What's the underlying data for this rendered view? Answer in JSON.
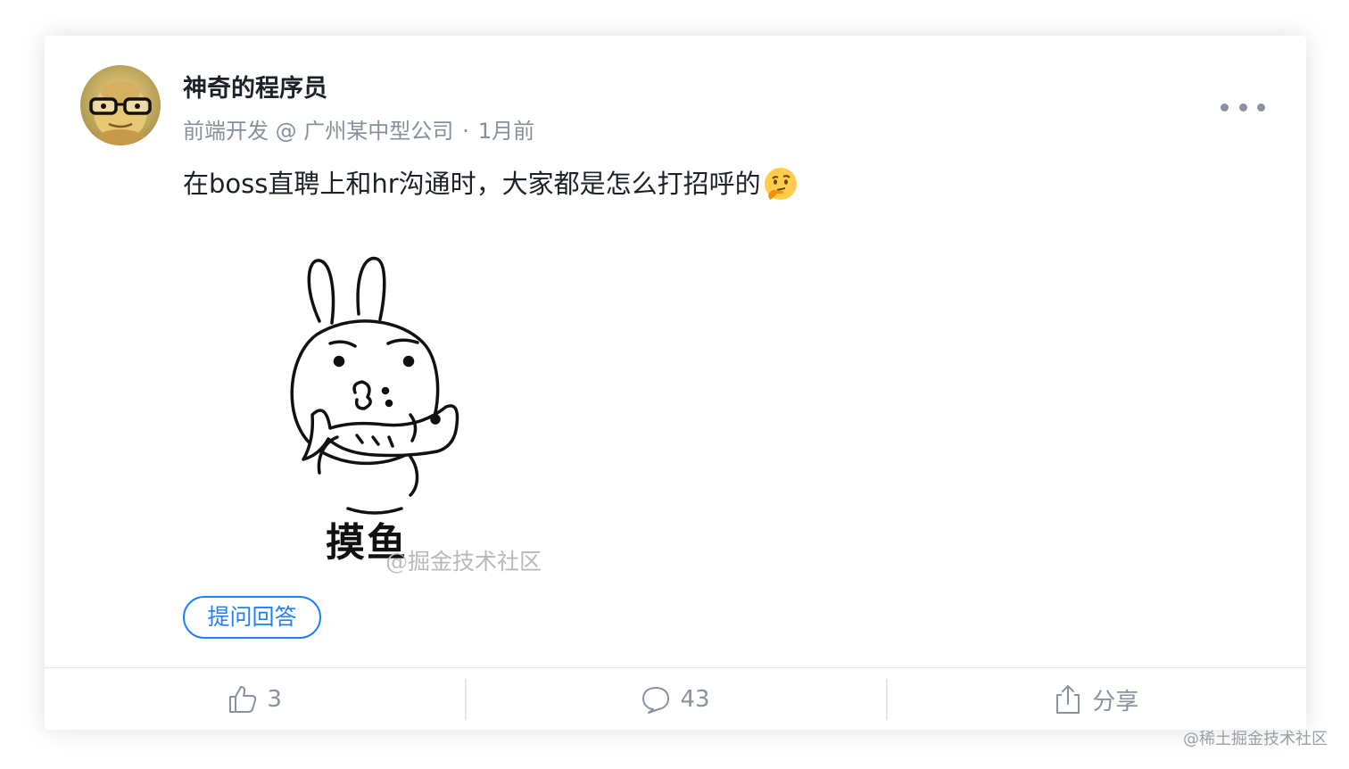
{
  "post": {
    "author": {
      "name": "神奇的程序员",
      "title": "前端开发 @ 广州某中型公司",
      "avatar_icon": "avatar-glasses-character"
    },
    "time": "1月前",
    "meta_separator": "·",
    "content": "在boss直聘上和hr沟通时，大家都是怎么打招呼的",
    "content_emoji": "thinking-face-emoji",
    "image": {
      "caption": "摸鱼",
      "watermark": "@掘金技术社区"
    },
    "tag": "提问回答"
  },
  "actions": {
    "like": {
      "icon": "thumbs-up-icon",
      "count": "3"
    },
    "comment": {
      "icon": "comment-bubble-icon",
      "count": "43"
    },
    "share": {
      "icon": "share-icon",
      "label": "分享"
    }
  },
  "page_watermark": "@稀土掘金技术社区",
  "colors": {
    "accent": "#1e80ff",
    "text_primary": "#1d2129",
    "text_secondary": "#86909c",
    "icon_gray": "#8a919f"
  }
}
